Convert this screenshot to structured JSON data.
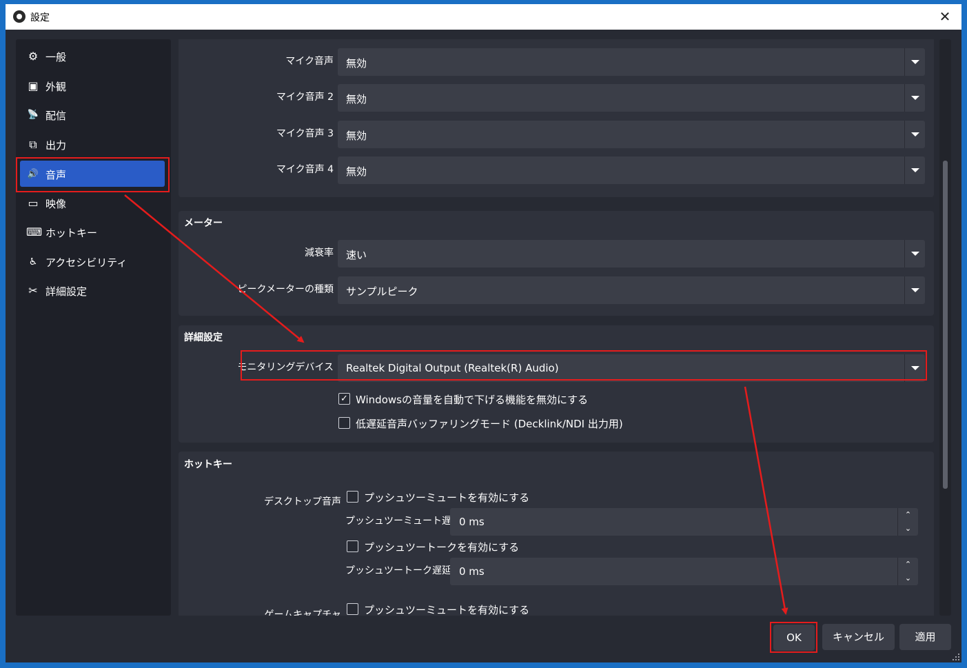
{
  "window": {
    "title": "設定",
    "close_glyph": "✕"
  },
  "sidebar": {
    "items": [
      {
        "label": "一般",
        "icon": "gear-icon",
        "glyph": "⚙"
      },
      {
        "label": "外観",
        "icon": "appearance-icon",
        "glyph": "▣"
      },
      {
        "label": "配信",
        "icon": "antenna-icon",
        "glyph": "📡"
      },
      {
        "label": "出力",
        "icon": "output-icon",
        "glyph": "⧉"
      },
      {
        "label": "音声",
        "icon": "speaker-icon",
        "glyph": "🔊"
      },
      {
        "label": "映像",
        "icon": "monitor-icon",
        "glyph": "▭"
      },
      {
        "label": "ホットキー",
        "icon": "keyboard-icon",
        "glyph": "⌨"
      },
      {
        "label": "アクセシビリティ",
        "icon": "accessibility-icon",
        "glyph": "♿"
      },
      {
        "label": "詳細設定",
        "icon": "tools-icon",
        "glyph": "✂"
      }
    ],
    "active": "音声"
  },
  "mic_section": {
    "rows": [
      {
        "label": "マイク音声",
        "value": "無効"
      },
      {
        "label": "マイク音声 2",
        "value": "無効"
      },
      {
        "label": "マイク音声 3",
        "value": "無効"
      },
      {
        "label": "マイク音声 4",
        "value": "無効"
      }
    ]
  },
  "meters": {
    "title": "メーター",
    "rows": [
      {
        "label": "減衰率",
        "value": "速い"
      },
      {
        "label": "ピークメーターの種類",
        "value": "サンプルピーク"
      }
    ]
  },
  "advanced": {
    "title": "詳細設定",
    "monitor_label": "モニタリングデバイス",
    "monitor_value": "Realtek Digital Output (Realtek(R) Audio)",
    "checks": [
      {
        "label": "Windowsの音量を自動で下げる機能を無効にする",
        "checked": true,
        "mark": "✓"
      },
      {
        "label": "低遅延音声バッファリングモード (Decklink/NDI 出力用)",
        "checked": false,
        "mark": ""
      }
    ]
  },
  "hotkeys": {
    "title": "ホットキー",
    "desktop_label": "デスクトップ音声",
    "ptm_enable": "プッシュツーミュートを有効にする",
    "ptm_delay_label": "プッシュツーミュート遅延",
    "ptm_delay_value": "0 ms",
    "ptt_enable": "プッシュツートークを有効にする",
    "ptt_delay_label": "プッシュツートーク遅延",
    "ptt_delay_value": "0 ms",
    "game_label": "ゲームキャプチャ",
    "game_ptm_enable": "プッシュツーミュートを有効にする",
    "spin_up": "⌃",
    "spin_down": "⌄"
  },
  "buttons": {
    "ok": "OK",
    "cancel": "キャンセル",
    "apply": "適用"
  },
  "colors": {
    "accent": "#2a5cc7",
    "annotation": "#e51c1c",
    "panel": "#2f323c",
    "background": "#272a33"
  }
}
